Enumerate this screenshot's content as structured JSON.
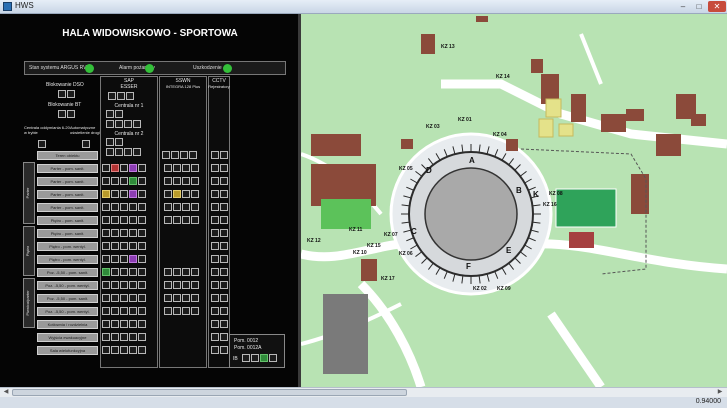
{
  "window": {
    "title": "HWS",
    "minimize": "–",
    "maximize": "□",
    "close": "✕"
  },
  "panel": {
    "title": "HALA WIDOWISKOWO - SPORTOWA",
    "status": {
      "system_label": "Stan systemu ARGUS RV:",
      "fire_label": "Alarm pożarowy",
      "damage_label": "Uszkodzenie"
    },
    "blocks": {
      "dso": "Blokowanie DSO",
      "bt": "Blokowanie BT",
      "central": "Centrala oddymiania 6-20 w trybie",
      "auto": "Automatyczne oświetlenie drogi ewak.",
      "col_sap": "SAP",
      "col_sap_sub": "ESSER",
      "central1": "Centrala nr 1",
      "central2": "Centrala nr 2",
      "col_sswn": "SSWN",
      "col_sswn_sub": "INTEGRA 128 Plus",
      "col_cctv": "CCTV",
      "col_cctv_sub": "Rejestratory",
      "teren": "Teren obiektu"
    },
    "groups": [
      {
        "label": "Parter"
      },
      {
        "label": "Piętro"
      },
      {
        "label": "Piwnica/parter"
      }
    ],
    "rows": [
      "Parter - pom. sanit.",
      "Parter - pom. sanit.",
      "Parter - pom. sanit.",
      "Parter - pom. sanit.",
      "Piętro - pom. sanit.",
      "Piętro - pom. sanit.",
      "Piętro - pom. wentyl.",
      "Piętro - pom. wentyl.",
      "Poz. -5,50 - pom. sanit.",
      "Poz. -5,50 - pom. wentyl.",
      "Poz. -5,50 - pom. sanit.",
      "Poz. -5,50 - pom. wentyl.",
      "Kotłownia / rozdzielnia",
      "Wyjścia ewakuacyjne",
      "Sala wielofunkcyjna"
    ],
    "info": {
      "line1": "Pom. 0012",
      "line2": "Pom. 0012A",
      "code": "IB"
    }
  },
  "map": {
    "sectors": [
      "A",
      "B",
      "C",
      "D",
      "E",
      "F",
      "K"
    ],
    "kz_labels": [
      "KZ 13",
      "KZ 14",
      "KZ 03",
      "KZ 01",
      "KZ 04",
      "KZ 05",
      "KZ 11",
      "KZ 12",
      "KZ 07",
      "KZ 15",
      "KZ 10",
      "KZ 06",
      "KZ 17",
      "KZ 08",
      "KZ 02",
      "KZ 09",
      "KZ 16"
    ]
  },
  "statusbar": {
    "zoom": "0.94000"
  },
  "colors": {
    "accent_green": "#34c03a",
    "map_green": "#b8e3b3",
    "building_brown": "#8b4a3a"
  }
}
